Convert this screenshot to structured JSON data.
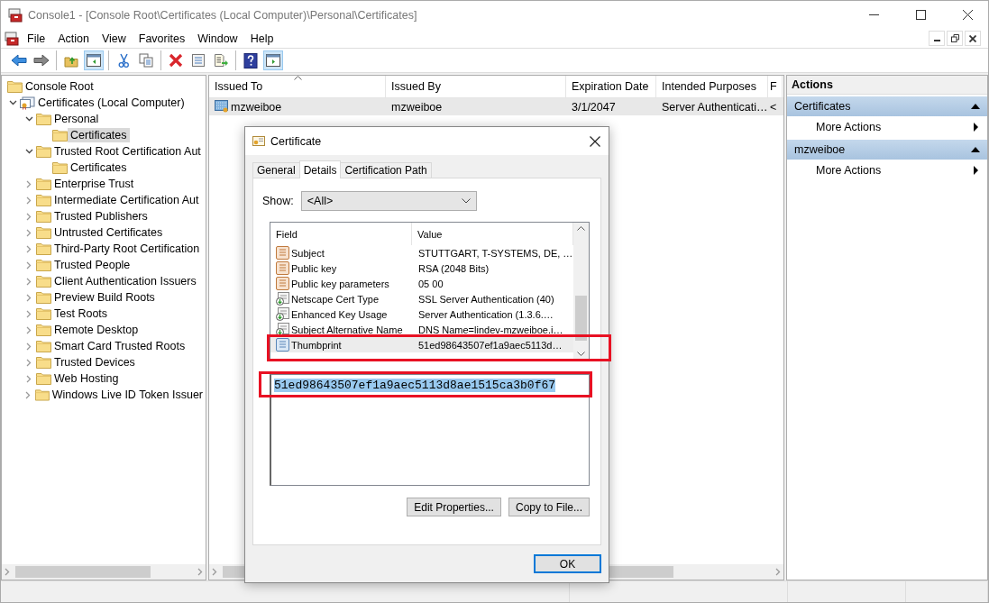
{
  "window": {
    "title": "Console1 - [Console Root\\Certificates (Local Computer)\\Personal\\Certificates]"
  },
  "menu": [
    "File",
    "Action",
    "View",
    "Favorites",
    "Window",
    "Help"
  ],
  "toolbar": [
    [
      {
        "kind": "back",
        "pressed": false
      },
      {
        "kind": "forward",
        "pressed": false
      }
    ],
    [
      {
        "kind": "up",
        "pressed": false
      },
      {
        "kind": "tree",
        "pressed": true
      }
    ],
    [
      {
        "kind": "cut",
        "pressed": false
      },
      {
        "kind": "copy",
        "pressed": false
      }
    ],
    [
      {
        "kind": "delete",
        "pressed": false
      },
      {
        "kind": "properties",
        "pressed": false
      },
      {
        "kind": "export",
        "pressed": false
      }
    ],
    [
      {
        "kind": "help",
        "pressed": false
      },
      {
        "kind": "actionpane",
        "pressed": true
      }
    ]
  ],
  "tree": [
    {
      "label": "Console Root",
      "kind": "folder",
      "selected": false,
      "children": [
        {
          "label": "Certificates (Local Computer)",
          "kind": "store",
          "expanded": true,
          "selected": false,
          "children": [
            {
              "label": "Personal",
              "kind": "folder",
              "expanded": true,
              "selected": false,
              "children": [
                {
                  "label": "Certificates",
                  "kind": "folder",
                  "selected": true
                }
              ]
            },
            {
              "label": "Trusted Root Certification Aut",
              "kind": "folder",
              "expanded": true,
              "selected": false,
              "children": [
                {
                  "label": "Certificates",
                  "kind": "folder",
                  "selected": false
                }
              ]
            },
            {
              "label": "Enterprise Trust",
              "kind": "folder",
              "expanded": false,
              "selected": false
            },
            {
              "label": "Intermediate Certification Aut",
              "kind": "folder",
              "expanded": false,
              "selected": false
            },
            {
              "label": "Trusted Publishers",
              "kind": "folder",
              "expanded": false,
              "selected": false
            },
            {
              "label": "Untrusted Certificates",
              "kind": "folder",
              "expanded": false,
              "selected": false
            },
            {
              "label": "Third-Party Root Certification",
              "kind": "folder",
              "expanded": false,
              "selected": false
            },
            {
              "label": "Trusted People",
              "kind": "folder",
              "expanded": false,
              "selected": false
            },
            {
              "label": "Client Authentication Issuers",
              "kind": "folder",
              "expanded": false,
              "selected": false
            },
            {
              "label": "Preview Build Roots",
              "kind": "folder",
              "expanded": false,
              "selected": false
            },
            {
              "label": "Test Roots",
              "kind": "folder",
              "expanded": false,
              "selected": false
            },
            {
              "label": "Remote Desktop",
              "kind": "folder",
              "expanded": false,
              "selected": false
            },
            {
              "label": "Smart Card Trusted Roots",
              "kind": "folder",
              "expanded": false,
              "selected": false
            },
            {
              "label": "Trusted Devices",
              "kind": "folder",
              "expanded": false,
              "selected": false
            },
            {
              "label": "Web Hosting",
              "kind": "folder",
              "expanded": false,
              "selected": false
            },
            {
              "label": "Windows Live ID Token Issuer",
              "kind": "folder",
              "expanded": false,
              "selected": false
            }
          ]
        }
      ]
    }
  ],
  "list": {
    "columns": [
      {
        "label": "Issued To",
        "sorted": true
      },
      {
        "label": "Issued By",
        "sorted": false
      },
      {
        "label": "Expiration Date",
        "sorted": false
      },
      {
        "label": "Intended Purposes",
        "sorted": false
      },
      {
        "label": "F",
        "sorted": false
      }
    ],
    "rows": [
      {
        "cells": [
          "mzweiboe",
          "mzweiboe",
          "3/1/2047",
          "Server Authenticati…",
          "<"
        ],
        "selected": true
      }
    ]
  },
  "actions": {
    "title": "Actions",
    "sections": [
      {
        "title": "Certificates",
        "expanded": true,
        "items": [
          "More Actions"
        ]
      },
      {
        "title": "mzweiboe",
        "expanded": true,
        "items": [
          "More Actions"
        ]
      }
    ]
  },
  "dialog": {
    "title": "Certificate",
    "tabs": [
      {
        "label": "General",
        "selected": false
      },
      {
        "label": "Details",
        "selected": true
      },
      {
        "label": "Certification Path",
        "selected": false
      }
    ],
    "show_label": "Show:",
    "show_value": "<All>",
    "columns": [
      "Field",
      "Value"
    ],
    "fields": [
      {
        "kind": "attribute",
        "field": "Subject",
        "value": "STUTTGART, T-SYSTEMS, DE, …",
        "selected": false,
        "highlighted": false
      },
      {
        "kind": "attribute",
        "field": "Public key",
        "value": "RSA (2048 Bits)",
        "selected": false,
        "highlighted": false
      },
      {
        "kind": "attribute",
        "field": "Public key parameters",
        "value": "05 00",
        "selected": false,
        "highlighted": false
      },
      {
        "kind": "extension",
        "field": "Netscape Cert Type",
        "value": "SSL Server Authentication (40)",
        "selected": false,
        "highlighted": false
      },
      {
        "kind": "extension",
        "field": "Enhanced Key Usage",
        "value": "Server Authentication (1.3.6.…",
        "selected": false,
        "highlighted": false
      },
      {
        "kind": "extension",
        "field": "Subject Alternative Name",
        "value": "DNS Name=lindev-mzweiboe.i…",
        "selected": false,
        "highlighted": false
      },
      {
        "kind": "property",
        "field": "Thumbprint",
        "value": "51ed98643507ef1a9aec5113d…",
        "selected": true,
        "highlighted": true
      }
    ],
    "detail": {
      "value": "51ed98643507ef1a9aec5113d8ae1515ca3b0f67",
      "highlighted": true
    },
    "buttons": [
      "Edit Properties...",
      "Copy to File..."
    ],
    "ok": "OK"
  }
}
